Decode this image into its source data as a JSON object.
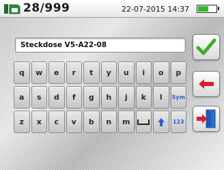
{
  "header": {
    "counter": "28/999",
    "datetime": "22-07-2015 14:37",
    "battery_level": 0.6,
    "icon": "memory-card-icon"
  },
  "input": {
    "value": "Steckdose V5-A22-08"
  },
  "keyboard": {
    "row1": [
      "q",
      "w",
      "e",
      "r",
      "t",
      "y",
      "u",
      "i",
      "o",
      "p"
    ],
    "row2": [
      "a",
      "s",
      "d",
      "f",
      "g",
      "h",
      "j",
      "k",
      "l",
      "Sym"
    ],
    "row3": [
      "z",
      "x",
      "c",
      "v",
      "b",
      "n",
      "m",
      "space-icon",
      "shift-arrow-icon",
      "123"
    ]
  },
  "buttons": {
    "ok": "check-icon",
    "back": "backspace-arrow-icon",
    "exit": "exit-door-icon"
  },
  "colors": {
    "ok_green": "#3fae2a",
    "back_red": "#d8202a",
    "key_blue": "#2a5bd8",
    "battery_green": "#2fb52f"
  }
}
